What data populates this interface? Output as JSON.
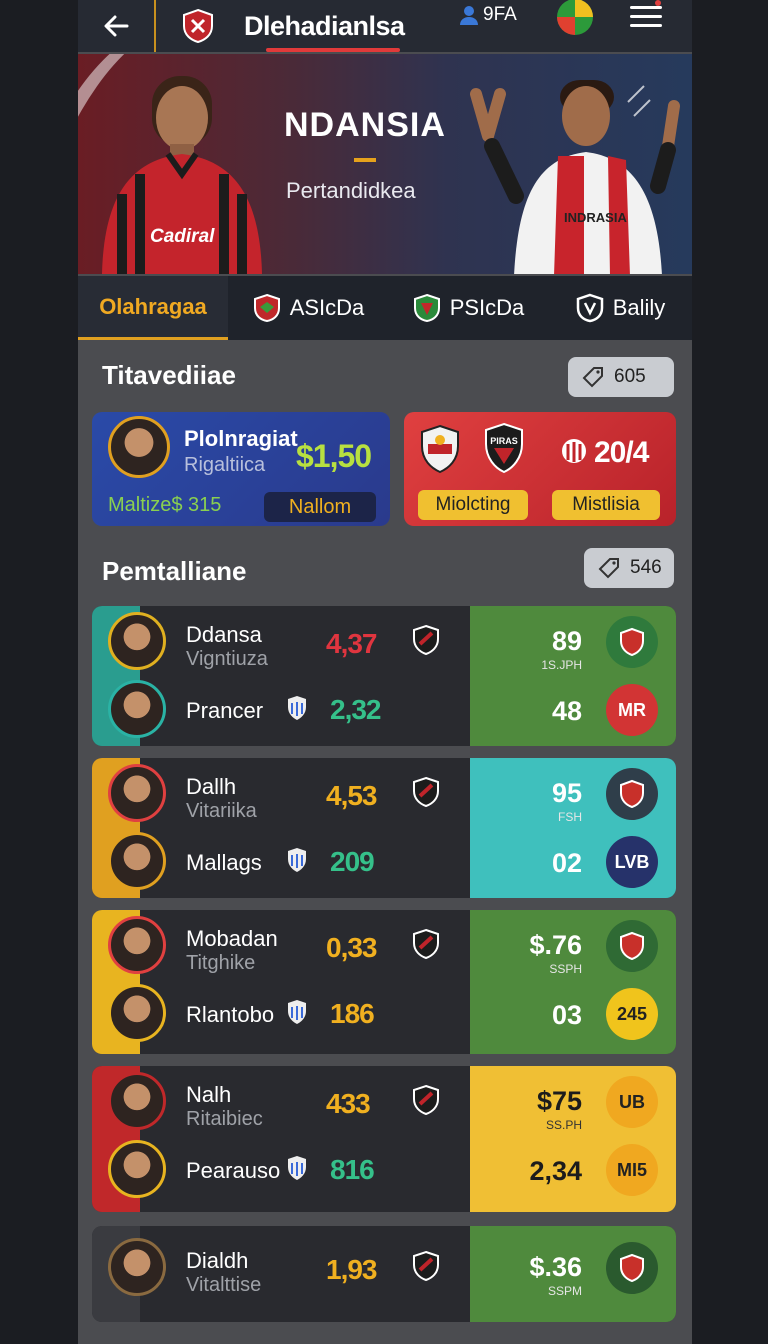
{
  "header": {
    "title": "Dlehadianlsa",
    "user_label": "9FA"
  },
  "hero": {
    "title": "NDANSIA",
    "subtitle": "Pertandidkea",
    "left_jersey_text": "Cadiral",
    "right_jersey_text": "INDRASIA"
  },
  "tabs": [
    {
      "label": "Olahragaa",
      "active": true
    },
    {
      "label": "ASIcDa",
      "active": false
    },
    {
      "label": "PSIcDa",
      "active": false
    },
    {
      "label": "Balily",
      "active": false
    }
  ],
  "featured": {
    "title": "Titavediiae",
    "pill_value": "605",
    "blue_card": {
      "name": "Plolnragiat",
      "sub": "Rigaltiica",
      "price": "$1,50",
      "footer_left": "Maltize$ 315",
      "button": "Nallom"
    },
    "red_card": {
      "score": "20/4",
      "badge_text": "PIRAS",
      "button_left": "Miolcting",
      "button_right": "Mistlisia"
    }
  },
  "list": {
    "title": "Pemtalliane",
    "pill_value": "546",
    "rows": [
      {
        "accent": "#2a9d8f",
        "right_bg": "#4f8a3d",
        "ring1": "#e0b020",
        "ring2": "#2ab3a5",
        "name1": "Ddansa",
        "sub1": "Vigntiuza",
        "odd1": "4,37",
        "odd1_color": "#e0353f",
        "name2": "Prancer",
        "odd2": "2,32",
        "odd2_color": "#35c08a",
        "rv1": "89",
        "rl1": "1S.JPH",
        "rv2": "48",
        "circ1": "",
        "circ1_bg": "#2f7a3c",
        "circ2": "MR",
        "circ2_bg": "#d23434"
      },
      {
        "accent": "#e0a020",
        "right_bg": "#3fc0bd",
        "ring1": "#e04040",
        "ring2": "#e0a020",
        "name1": "Dallh",
        "sub1": "Vitariika",
        "odd1": "4,53",
        "odd1_color": "#f0b020",
        "name2": "Mallags",
        "odd2": "209",
        "odd2_color": "#35c08a",
        "rv1": "95",
        "rl1": "FSH",
        "rv2": "02",
        "circ1": "",
        "circ1_bg": "#2f3e4a",
        "circ2": "LVB",
        "circ2_bg": "#26326a"
      },
      {
        "accent": "#e8b420",
        "right_bg": "#4f8a3d",
        "ring1": "#e04040",
        "ring2": "#e8b420",
        "name1": "Mobadan",
        "sub1": "Titghike",
        "odd1": "0,33",
        "odd1_color": "#f0b020",
        "name2": "Rlantobo",
        "odd2": "186",
        "odd2_color": "#f0b020",
        "rv1": "$.76",
        "rl1": "SSPH",
        "rv2": "03",
        "circ1": "",
        "circ1_bg": "#2f6a34",
        "circ2": "245",
        "circ2_bg": "#f0c41c"
      },
      {
        "accent": "#c0282a",
        "right_bg": "#f0bf34",
        "ring1": "#c0282a",
        "ring2": "#e8b420",
        "name1": "Nalh",
        "sub1": "Ritaibiec",
        "odd1": "433",
        "odd1_color": "#f0b020",
        "name2": "Pearauso",
        "odd2": "816",
        "odd2_color": "#35c08a",
        "rv1": "$75",
        "rl1": "SS.PH",
        "rv2": "2,34",
        "circ1": "UB",
        "circ1_bg": "#f0a820",
        "circ2": "MI5",
        "circ2_bg": "#f0a820"
      },
      {
        "accent": "#3a3b40",
        "right_bg": "#4f8a3d",
        "ring1": "#8a6a40",
        "ring2": "#8a6a40",
        "name1": "Dialdh",
        "sub1": "Vitalttise",
        "odd1": "1,93",
        "odd1_color": "#f0b020",
        "name2": "",
        "odd2": "",
        "odd2_color": "#35c08a",
        "rv1": "$.36",
        "rl1": "SSPM",
        "rv2": "",
        "circ1": "",
        "circ1_bg": "#2a5a2e",
        "circ2": "",
        "circ2_bg": "transparent"
      }
    ]
  }
}
